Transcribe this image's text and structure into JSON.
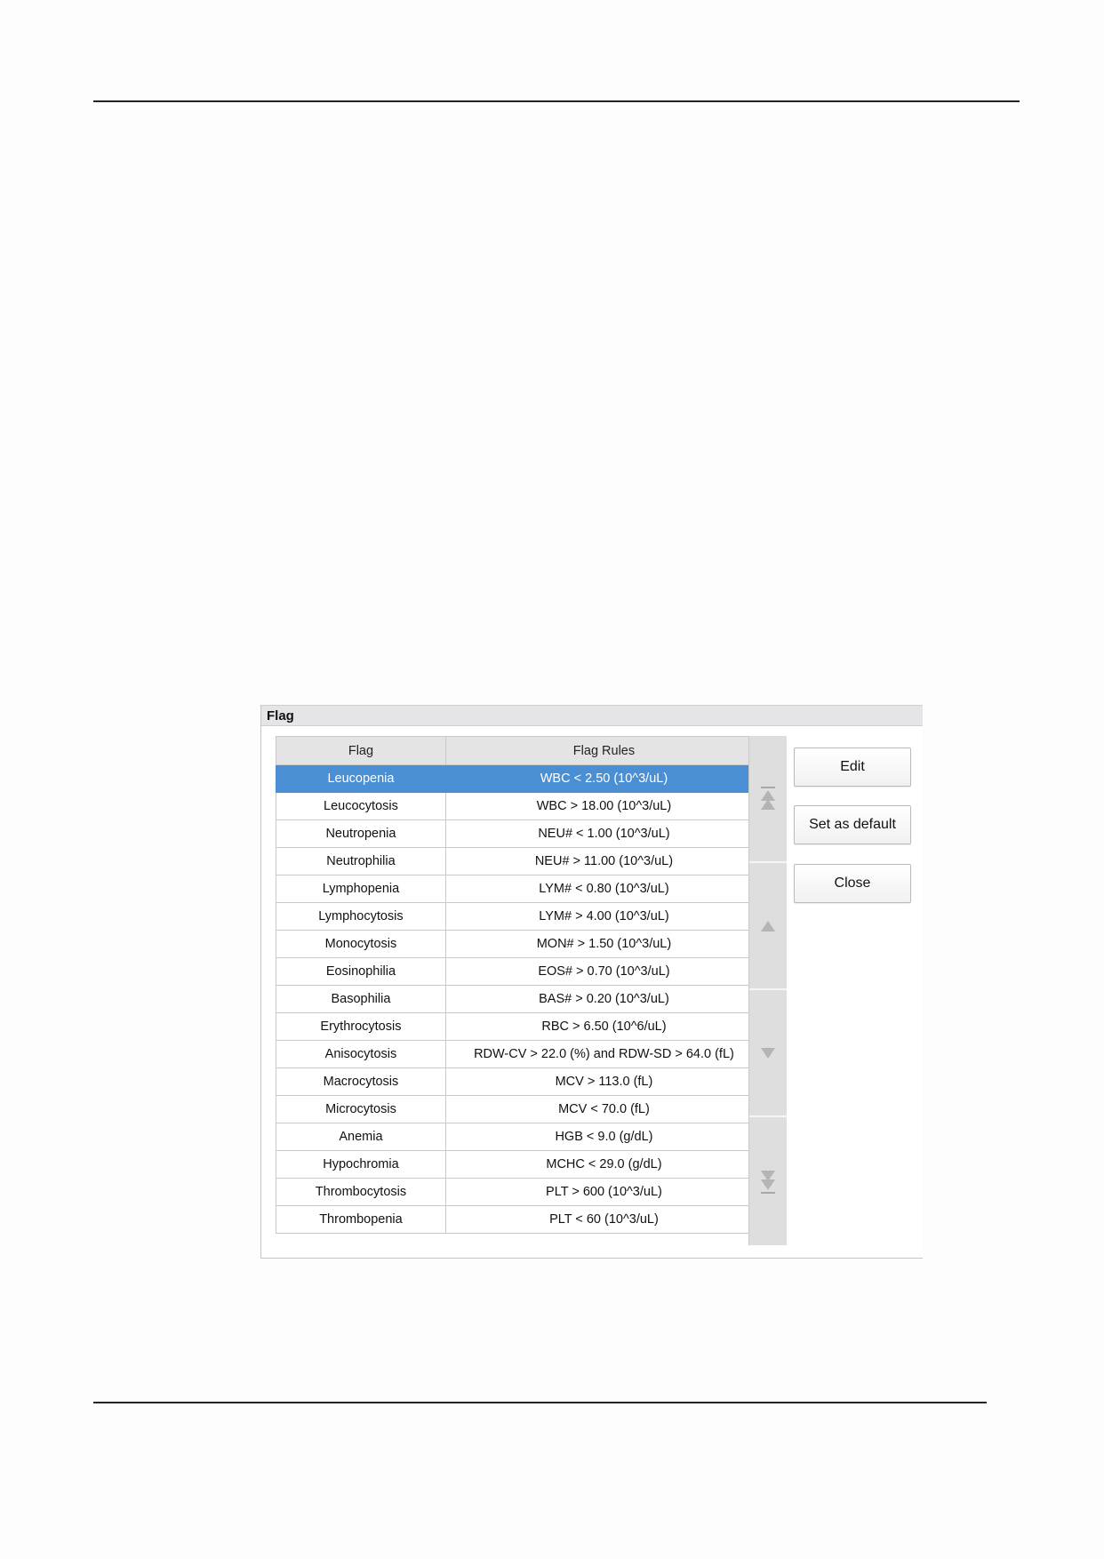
{
  "dialog": {
    "title": "Flag"
  },
  "table": {
    "headers": [
      "Flag",
      "Flag Rules"
    ],
    "selected_index": 0,
    "rows": [
      {
        "flag": "Leucopenia",
        "rule": "WBC < 2.50 (10^3/uL)"
      },
      {
        "flag": "Leucocytosis",
        "rule": "WBC > 18.00 (10^3/uL)"
      },
      {
        "flag": "Neutropenia",
        "rule": "NEU# < 1.00 (10^3/uL)"
      },
      {
        "flag": "Neutrophilia",
        "rule": "NEU# > 11.00 (10^3/uL)"
      },
      {
        "flag": "Lymphopenia",
        "rule": "LYM# < 0.80 (10^3/uL)"
      },
      {
        "flag": "Lymphocytosis",
        "rule": "LYM# > 4.00 (10^3/uL)"
      },
      {
        "flag": "Monocytosis",
        "rule": "MON# > 1.50 (10^3/uL)"
      },
      {
        "flag": "Eosinophilia",
        "rule": "EOS# > 0.70 (10^3/uL)"
      },
      {
        "flag": "Basophilia",
        "rule": "BAS# > 0.20 (10^3/uL)"
      },
      {
        "flag": "Erythrocytosis",
        "rule": "RBC > 6.50 (10^6/uL)"
      },
      {
        "flag": "Anisocytosis",
        "rule": "RDW-CV > 22.0 (%) and RDW-SD > 64.0 (fL)"
      },
      {
        "flag": "Macrocytosis",
        "rule": "MCV > 113.0 (fL)"
      },
      {
        "flag": "Microcytosis",
        "rule": "MCV < 70.0 (fL)"
      },
      {
        "flag": "Anemia",
        "rule": "HGB < 9.0 (g/dL)"
      },
      {
        "flag": "Hypochromia",
        "rule": "MCHC < 29.0 (g/dL)"
      },
      {
        "flag": "Thrombocytosis",
        "rule": "PLT > 600 (10^3/uL)"
      },
      {
        "flag": "Thrombopenia",
        "rule": "PLT < 60 (10^3/uL)"
      }
    ]
  },
  "scroll_controls": [
    {
      "name": "scroll-to-top-icon"
    },
    {
      "name": "scroll-up-icon"
    },
    {
      "name": "scroll-down-icon"
    },
    {
      "name": "scroll-to-bottom-icon"
    }
  ],
  "buttons": {
    "edit_label": "Edit",
    "set_default_label": "Set as default",
    "close_label": "Close"
  },
  "colors": {
    "selected_row": "#4a8fd3",
    "header_bg": "#e4e4e4",
    "scrollbar_bg": "#dedede"
  }
}
